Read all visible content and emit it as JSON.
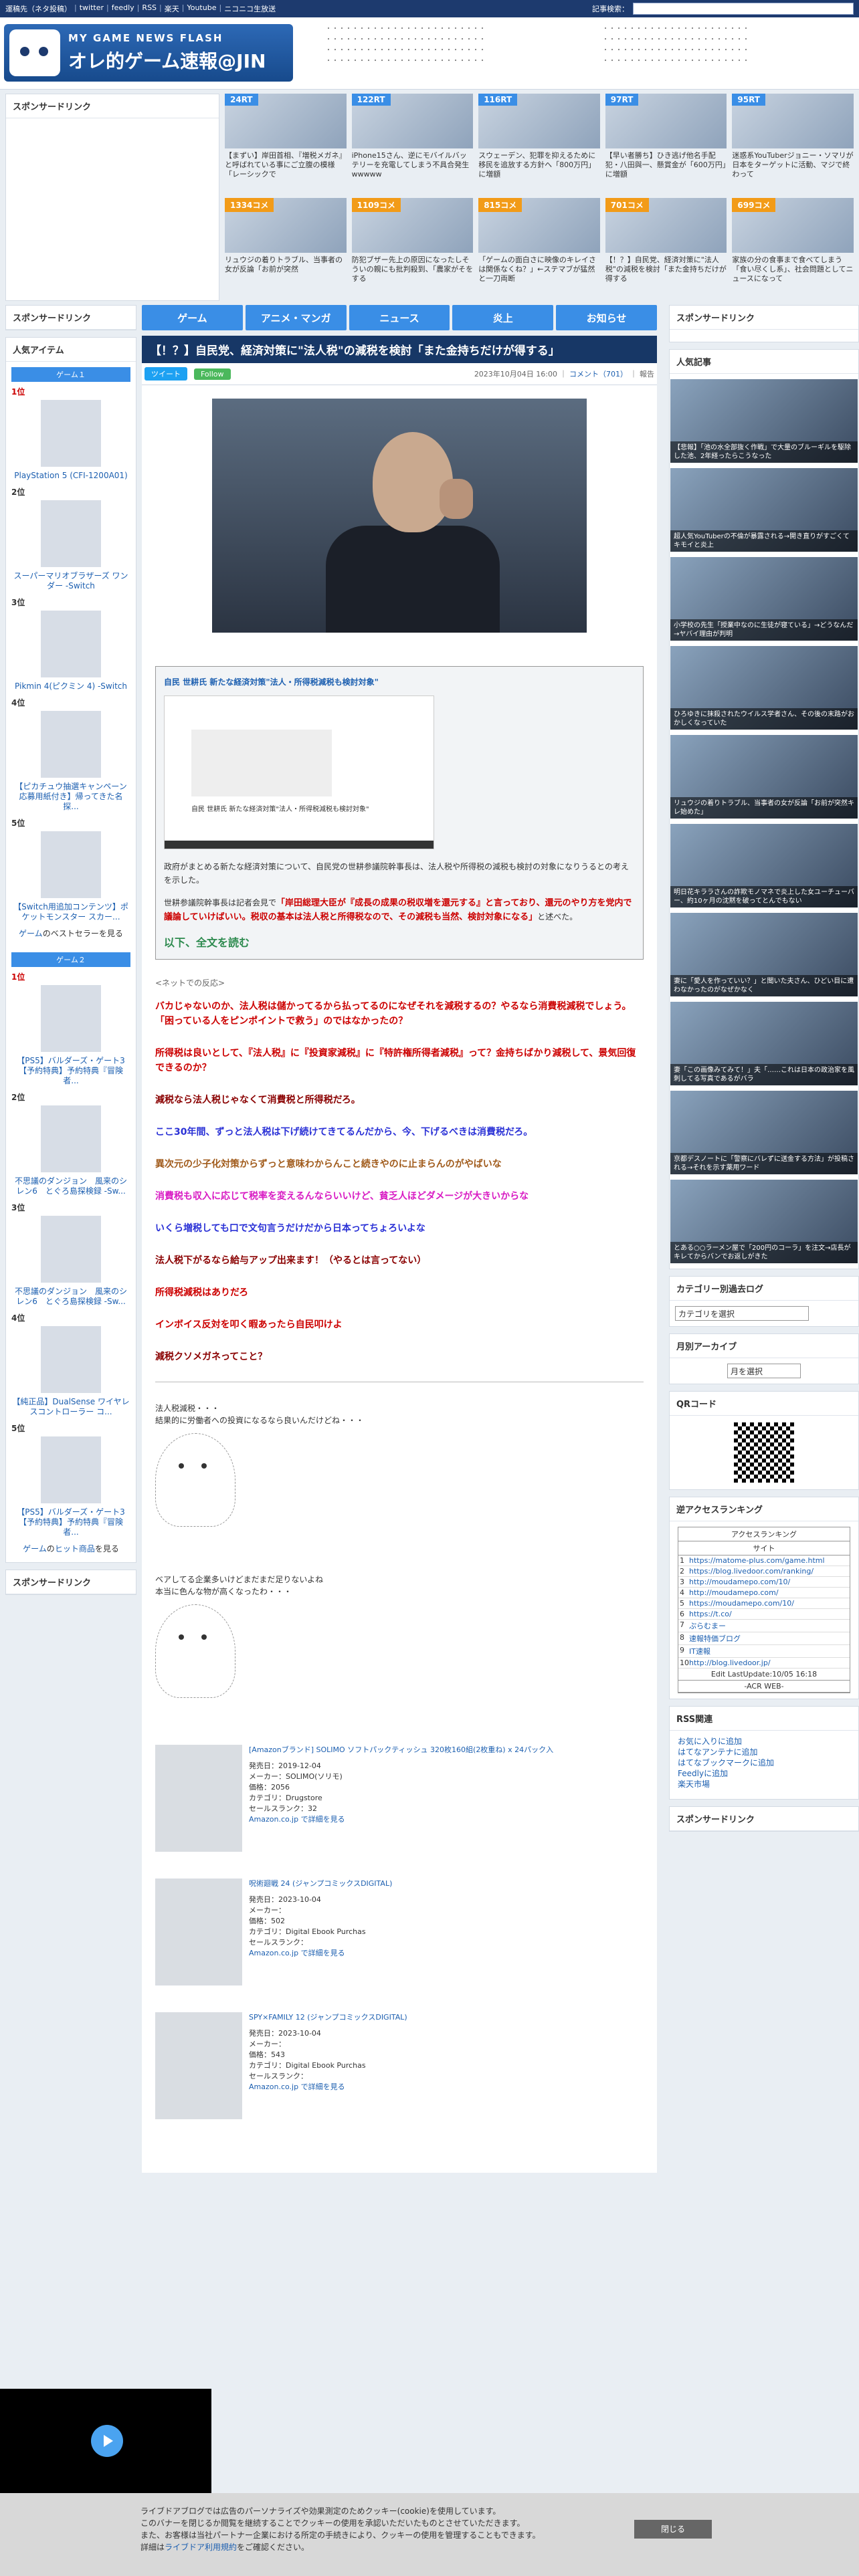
{
  "topbar": {
    "links": [
      "運稿先（ネタ投稿）",
      "twitter",
      "feedly",
      "RSS",
      "楽天",
      "Youtube",
      "ニコニコ生放送"
    ],
    "search_label": "記事検索："
  },
  "logo": {
    "sub": "MY GAME NEWS FLASH",
    "main": "オレ的ゲーム速報@JIN"
  },
  "sponsor_label": "スポンサードリンク",
  "rank_cards": [
    {
      "badge": "24RT",
      "type": "rt",
      "caption": "【まずい】岸田首相、『増税メガネ』と呼ばれている事にご立腹の模様「レーシックで"
    },
    {
      "badge": "122RT",
      "type": "rt",
      "caption": "iPhone15さん、逆にモバイルバッテリーを充電してしまう不具合発生wwwww"
    },
    {
      "badge": "116RT",
      "type": "rt",
      "caption": "スウェーデン、犯罪を抑えるために移民を追放する方針へ「800万円」に増額"
    },
    {
      "badge": "97RT",
      "type": "rt",
      "caption": "【早い者勝ち】ひき逃げ他名手配犯・八田與一、懸賞金が「600万円」に増額"
    },
    {
      "badge": "95RT",
      "type": "rt",
      "caption": "迷惑系YouTuberジョニー・ソマリが日本をターゲットに活動、マジで終わって"
    },
    {
      "badge": "1334コメ",
      "type": "com",
      "caption": "リュウジの着りトラブル、当事者の女が反論「お前が突然"
    },
    {
      "badge": "1109コメ",
      "type": "com",
      "caption": "防犯ブザー先上の原因になったしそういの親にも批判殺到、「農家がそをする"
    },
    {
      "badge": "815コメ",
      "type": "com",
      "caption": "「ゲームの面白さに映像のキレイさは関係なくね？」←ステマブが猛然と一刀両断"
    },
    {
      "badge": "701コメ",
      "type": "com",
      "caption": "【！？】自民党、経済対策に\"法人税\"の減税を検討「また金持ちだけが得する"
    },
    {
      "badge": "699コメ",
      "type": "com",
      "caption": "家族の分の食事まで食べてしまう「食い尽くし系」、社会問題としてニュースになって"
    }
  ],
  "nav": [
    "ゲーム",
    "アニメ・マンガ",
    "ニュース",
    "炎上",
    "お知らせ"
  ],
  "article": {
    "title": "【！？】自民党、経済対策に\"法人税\"の減税を検討「また金持ちだけが得する」",
    "tweet": "ツイート",
    "follow": "Follow",
    "date": "2023年10月04日 16:00",
    "comment_label": "コメント（701）",
    "report": "報告",
    "quote_title": "自民 世耕氏 新たな経済対策\"法人・所得税減税も検討対象\"",
    "quote_img_title": "自民 世耕氏 新たな経済対策\"法人・所得税減税も検討対象\"",
    "quote_p1": "政府がまとめる新たな経済対策について、自民党の世耕参議院幹事長は、法人税や所得税の減税も検討の対象になりうるとの考えを示した。",
    "quote_p2_a": "世耕参議院幹事長は記者会見で",
    "quote_p2_red": "「岸田総理大臣が『成長の成果の税収増を還元する』と言っており、還元のやり方を党内で議論していけばいい。税収の基本は法人税と所得税なので、その減税も当然、検討対象になる」",
    "quote_p2_b": "と述べた。",
    "more": "以下、全文を読む",
    "net_label": "<ネットでの反応>",
    "comments": [
      {
        "cls": "c-red",
        "text": "バカじゃないのか、法人税は儲かってるから払ってるのになぜそれを減税するの？やるなら消費税減税でしょう。「困っている人をピンポイントで救う」のではなかったの？"
      },
      {
        "cls": "c-red",
        "text": "所得税は良いとして、『法人税』に『投資家減税』に『特許権所得者減税』って？金持ちばかり減税して、景気回復できるのか？"
      },
      {
        "cls": "c-darkred",
        "text": "減税なら法人税じゃなくて消費税と所得税だろ。"
      },
      {
        "cls": "c-blue",
        "text": "ここ30年間、ずっと法人税は下げ続けてきてるんだから、今、下げるべきは消費税だろ。"
      },
      {
        "cls": "c-brown",
        "text": "異次元の少子化対策からずっと意味わからんこと続きやのに止まらんのがやばいな"
      },
      {
        "cls": "c-magenta",
        "text": "消費税も収入に応じて税率を変えるんならいいけど、貧乏人ほどダメージが大きいからな"
      },
      {
        "cls": "c-blue",
        "text": "いくら増税しても口で文句言うだけだから日本ってちょろいよな"
      },
      {
        "cls": "c-darkred",
        "text": "法人税下がるなら給与アップ出来ます！（やるとは言ってない）"
      },
      {
        "cls": "c-red",
        "text": "所得税減税はありだろ"
      },
      {
        "cls": "c-red",
        "text": "インボイス反対を叩く暇あったら自民叩けよ"
      },
      {
        "cls": "c-darkred",
        "text": "減税クソメガネってこと？"
      }
    ],
    "aa1": [
      "法人税減税・・・",
      "結果的に労働者への投資になるなら良いんだけどね・・・"
    ],
    "aa2": [
      "ベアしてる企業多いけどまだまだ足りないよね",
      "本当に色んな物が高くなったわ・・・"
    ],
    "products": [
      {
        "title": "[Amazonブランド] SOLIMO ソフトパックティッシュ 320枚160組(2枚重ね) x 24パック入",
        "date": "発売日：2019-12-04",
        "maker": "メーカー：SOLIMO(ソリモ)",
        "price": "価格：2056",
        "cat": "カテゴリ：Drugstore",
        "rank": "セールスランク：32",
        "link": "Amazon.co.jp で詳細を見る"
      },
      {
        "title": "呪術廻戦 24 (ジャンプコミックスDIGITAL)",
        "date": "発売日：2023-10-04",
        "maker": "メーカー：",
        "price": "価格：502",
        "cat": "カテゴリ：Digital Ebook Purchas",
        "rank": "セールスランク：",
        "link": "Amazon.co.jp で詳細を見る"
      },
      {
        "title": "SPY×FAMILY 12 (ジャンプコミックスDIGITAL)",
        "date": "発売日：2023-10-04",
        "maker": "メーカー：",
        "price": "価格：543",
        "cat": "カテゴリ：Digital Ebook Purchas",
        "rank": "セールスランク：",
        "link": "Amazon.co.jp で詳細を見る"
      }
    ]
  },
  "left": {
    "popular_title": "人気アイテム",
    "game1": "ゲーム１",
    "game2": "ゲーム２",
    "items1": [
      {
        "rank": "1位",
        "name": "PlayStation 5 (CFI-1200A01)"
      },
      {
        "rank": "2位",
        "name": "スーパーマリオブラザーズ ワンダー -Switch"
      },
      {
        "rank": "3位",
        "name": "Pikmin 4(ピクミン 4) -Switch"
      },
      {
        "rank": "4位",
        "name": "【ピカチュウ抽選キャンペーン応募用紙付き】帰ってきた名探..."
      },
      {
        "rank": "5位",
        "name": "【Switch用追加コンテンツ】ポケットモンスター スカー..."
      }
    ],
    "more1": [
      "ゲーム",
      "のベストセラーを見る"
    ],
    "items2": [
      {
        "rank": "1位",
        "name": "【PS5】バルダーズ・ゲート3【予約特典】予約特典『冒険者..."
      },
      {
        "rank": "2位",
        "name": "不思議のダンジョン　風来のシレン6　とぐろ島探検録 -Sw..."
      },
      {
        "rank": "3位",
        "name": "不思議のダンジョン　風来のシレン6　とぐろ島探検録 -Sw..."
      },
      {
        "rank": "4位",
        "name": "【純正品】DualSense ワイヤレスコントローラー コ..."
      },
      {
        "rank": "5位",
        "name": "【PS5】バルダーズ・ゲート3【予約特典】予約特典『冒険者..."
      }
    ],
    "more2": [
      "ゲーム",
      "の",
      "ヒット商品",
      "を見る"
    ]
  },
  "right": {
    "popular_title": "人気記事",
    "articles": [
      "【悲報】「池の水全部抜く作戦」で大量のブルーギルを駆除した池、2年経ったらこうなった",
      "超人気YouTuberの不倫が暴露される→開き直りがすごくてキモイと炎上",
      "小学校の先生「授業中なのに生徒が寝ている」→どうなんだ→ヤバイ理由が判明",
      "ひろゆきに抹殺されたウイルス学者さん、その後の末路がおかしくなっていた",
      "リュウジの着りトラブル、当事者の女が反論「お前が突然キレ始めた」",
      "明日花キララさんの詐欺モノマネで炎上した女ユーチューバー、約10ヶ月の沈黙を破ってとんでもない",
      "妻に「愛人を作っていい？」と聞いた夫さん、ひどい目に遭わなかったのがなぜかなく",
      "妻「この画像みてみて！」夫「……これは日本の政治家を風刺してる写真であるがバラ",
      "京都デスノートに「警察にバレずに送金する方法」が投稿される→それを示す薬用ワード",
      "とある○○ラーメン屋で「200円のコーラ」を注文→店長がキレてからバンでお返しがきた"
    ],
    "category_title": "カテゴリー別過去ログ",
    "category_select": "カテゴリを選択",
    "archive_title": "月別アーカイブ",
    "archive_select": "月を選択",
    "qr_title": "QRコード",
    "access_title": "逆アクセスランキング",
    "access_head": "アクセスランキング",
    "access_sub": "サイト",
    "access_rows": [
      {
        "n": "1",
        "u": "https://matome-plus.com/game.html"
      },
      {
        "n": "2",
        "u": "https://blog.livedoor.com/ranking/"
      },
      {
        "n": "3",
        "u": "http://moudamepo.com/10/"
      },
      {
        "n": "4",
        "u": "http://moudamepo.com/"
      },
      {
        "n": "5",
        "u": "https://moudamepo.com/10/"
      },
      {
        "n": "6",
        "u": "https://t.co/"
      },
      {
        "n": "7",
        "u": "ぷらむまー"
      },
      {
        "n": "8",
        "u": "速報特価ブログ"
      },
      {
        "n": "9",
        "u": "IT速報"
      },
      {
        "n": "10",
        "u": "http://blog.livedoor.jp/"
      }
    ],
    "access_foot": "Edit LastUpdate:10/05 16:18",
    "access_brand": "-ACR WEB-",
    "rss_title": "RSS関連",
    "rss_links": [
      "お気に入りに追加",
      "はてなアンテナに追加",
      "はてなブックマークに追加",
      "Feedlyに追加",
      "楽天市場"
    ]
  },
  "cookie": {
    "l1": "ライブドアブログでは広告のパーソナライズや効果測定のためクッキー(cookie)を使用しています。",
    "l2": "このバナーを閉じるか閲覧を継続することでクッキーの使用を承認いただいたものとさせていただきます。",
    "l3": "また、お客様は当社パートナー企業における所定の手続きにより、クッキーの使用を管理することもできます。",
    "l4a": "詳細は",
    "l4link": "ライブドア利用規約",
    "l4b": "をご確認ください。",
    "close": "閉じる"
  }
}
